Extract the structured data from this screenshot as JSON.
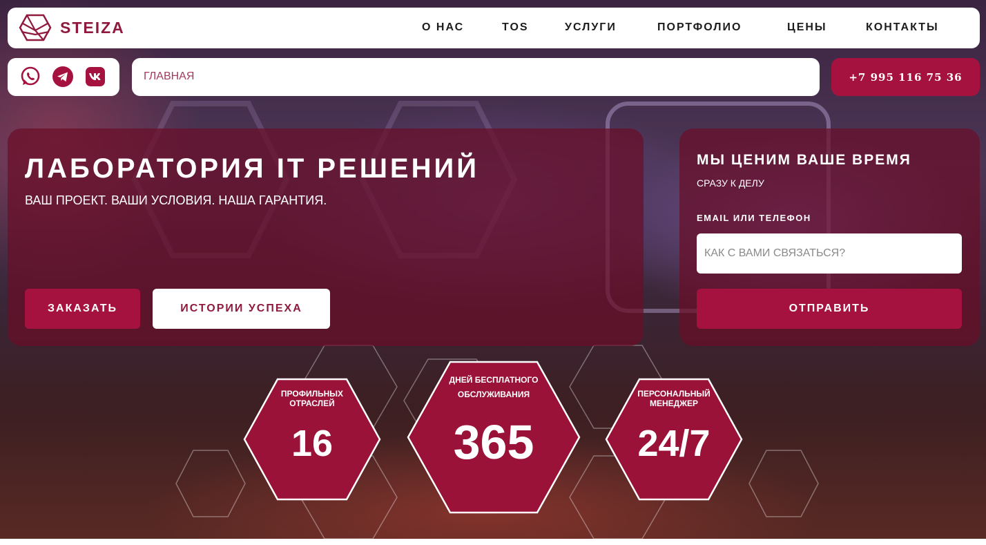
{
  "header": {
    "brand": "STEIZA",
    "nav": [
      "О НАС",
      "TOS",
      "УСЛУГИ",
      "ПОРТФОЛИО",
      "ЦЕНЫ",
      "КОНТАКТЫ"
    ]
  },
  "socials": [
    "whatsapp-icon",
    "telegram-icon",
    "vk-icon"
  ],
  "breadcrumb": "ГЛАВНАЯ",
  "phone": "+7 995 116 75 36",
  "hero": {
    "title": "ЛАБОРАТОРИЯ IT РЕШЕНИЙ",
    "subtitle": "ВАШ ПРОЕКТ. ВАШИ УСЛОВИЯ. НАША ГАРАНТИЯ.",
    "order_button": "ЗАКАЗАТЬ",
    "stories_button": "ИСТОРИИ УСПЕХА"
  },
  "form": {
    "title": "МЫ ЦЕНИМ ВАШЕ ВРЕМЯ",
    "subtitle": "СРАЗУ К ДЕЛУ",
    "field_label": "EMAIL ИЛИ ТЕЛЕФОН",
    "field_placeholder": "КАК С ВАМИ СВЯЗАТЬСЯ?",
    "submit": "ОТПРАВИТЬ"
  },
  "stats": [
    {
      "label_line1": "ПРОФИЛЬНЫХ",
      "label_line2": "ОТРАСЛЕЙ",
      "value": "16"
    },
    {
      "label_line1": "ДНЕЙ БЕСПЛАТНОГО",
      "label_line2": "ОБСЛУЖИВАНИЯ",
      "value": "365"
    },
    {
      "label_line1": "ПЕРСОНАЛЬНЫЙ",
      "label_line2": "МЕНЕДЖЕР",
      "value": "24/7"
    }
  ],
  "colors": {
    "accent": "#a5123f",
    "brand": "#8f1a3d",
    "panel": "#690e28"
  }
}
